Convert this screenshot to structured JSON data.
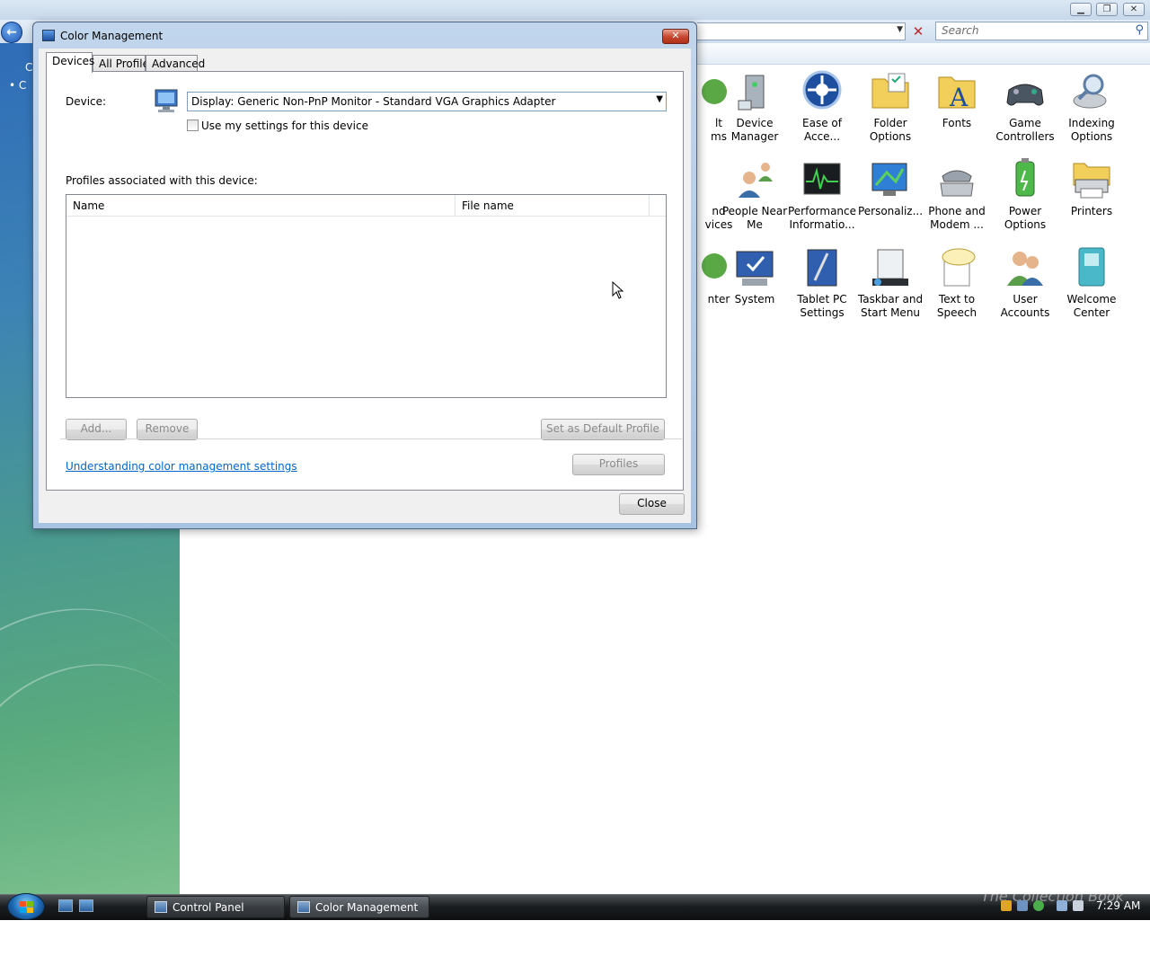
{
  "control_panel": {
    "search_placeholder": "Search",
    "sidebar_links": [
      "C",
      "C"
    ],
    "items": [
      {
        "label": "lt\nms",
        "icon": "programs-icon"
      },
      {
        "label": "Device Manager",
        "icon": "device-manager-icon"
      },
      {
        "label": "Ease of Acce...",
        "icon": "ease-of-access-icon"
      },
      {
        "label": "Folder Options",
        "icon": "folder-options-icon"
      },
      {
        "label": "Fonts",
        "icon": "fonts-icon"
      },
      {
        "label": "Game Controllers",
        "icon": "game-controllers-icon"
      },
      {
        "label": "Indexing Options",
        "icon": "indexing-options-icon"
      },
      {
        "label": "nd\nvices",
        "icon": "devices-icon"
      },
      {
        "label": "People Near Me",
        "icon": "people-near-me-icon"
      },
      {
        "label": "Performance Informatio...",
        "icon": "performance-icon"
      },
      {
        "label": "Personaliz...",
        "icon": "personalization-icon"
      },
      {
        "label": "Phone and Modem ...",
        "icon": "phone-modem-icon"
      },
      {
        "label": "Power Options",
        "icon": "power-options-icon"
      },
      {
        "label": "Printers",
        "icon": "printers-icon"
      },
      {
        "label": "nter",
        "icon": "center-icon"
      },
      {
        "label": "System",
        "icon": "system-icon"
      },
      {
        "label": "Tablet PC Settings",
        "icon": "tablet-pc-icon"
      },
      {
        "label": "Taskbar and Start Menu",
        "icon": "taskbar-icon"
      },
      {
        "label": "Text to Speech",
        "icon": "text-to-speech-icon"
      },
      {
        "label": "User Accounts",
        "icon": "user-accounts-icon"
      },
      {
        "label": "Welcome Center",
        "icon": "welcome-center-icon"
      }
    ]
  },
  "dialog": {
    "title": "Color Management",
    "close_glyph": "✕",
    "tabs": [
      "Devices",
      "All Profiles",
      "Advanced"
    ],
    "device_label": "Device:",
    "device_value": "Display: Generic Non-PnP Monitor - Standard VGA Graphics Adapter",
    "use_settings_label": "Use my settings for this device",
    "use_settings_checked": false,
    "profiles_caption": "Profiles associated with this device:",
    "columns": [
      "Name",
      "File name"
    ],
    "buttons": {
      "add": "Add...",
      "remove": "Remove",
      "set_default": "Set as Default Profile",
      "profiles": "Profiles",
      "close": "Close"
    },
    "help_link": "Understanding color management settings"
  },
  "taskbar": {
    "tasks": [
      "Control Panel",
      "Color Management"
    ],
    "clock": "7:29 AM",
    "watermark": "The Collection Book"
  },
  "colors": {
    "link": "#0066cc",
    "dialog_frame": "#b4cce7",
    "sidebar_top": "#2f6db8",
    "sidebar_bottom": "#7cc08e"
  }
}
